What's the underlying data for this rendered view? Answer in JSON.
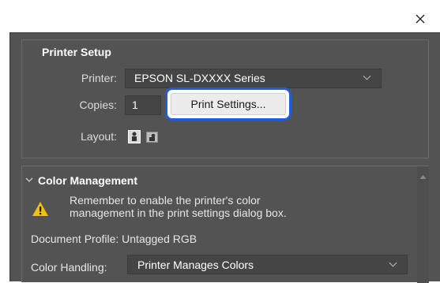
{
  "window": {
    "close_icon": "close-icon"
  },
  "printer_setup": {
    "title": "Printer Setup",
    "printer_label": "Printer:",
    "printer_value": "EPSON SL-DXXXX Series",
    "copies_label": "Copies:",
    "copies_value": "1",
    "print_settings_label": "Print Settings...",
    "layout_label": "Layout:",
    "layout_icons": [
      "portrait-layout-icon",
      "landscape-layout-icon"
    ]
  },
  "color_management": {
    "title": "Color Management",
    "warning_icon": "warning-icon",
    "warning_line1": "Remember to enable the printer's color",
    "warning_line2": "management in the print settings dialog box.",
    "document_profile": "Document Profile: Untagged RGB",
    "color_handling_label": "Color Handling:",
    "color_handling_value": "Printer Manages Colors"
  },
  "colors": {
    "dialog_bg": "#535353",
    "control_bg": "#454545",
    "highlight": "#1e5ed9",
    "warning": "#f2c200"
  }
}
